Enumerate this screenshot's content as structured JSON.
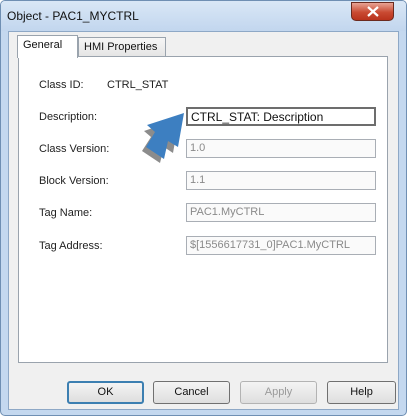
{
  "window": {
    "title": "Object - PAC1_MYCTRL"
  },
  "tabs": [
    {
      "label": "General"
    },
    {
      "label": "HMI Properties"
    }
  ],
  "general": {
    "class_id_label": "Class ID:",
    "class_id_value": "CTRL_STAT",
    "description_label": "Description:",
    "description_value": "CTRL_STAT: Description",
    "class_version_label": "Class Version:",
    "class_version_value": "1.0",
    "block_version_label": "Block Version:",
    "block_version_value": "1.1",
    "tag_name_label": "Tag Name:",
    "tag_name_value": "PAC1.MyCTRL",
    "tag_address_label": "Tag Address:",
    "tag_address_value": "$[1556617731_0]PAC1.MyCTRL"
  },
  "buttons": {
    "ok": "OK",
    "cancel": "Cancel",
    "apply": "Apply",
    "help": "Help"
  },
  "icons": {
    "close": "close-icon",
    "pointer": "pointer-arrow-icon"
  },
  "colors": {
    "title_bar": "#c2d6ee",
    "close_button": "#c94a32",
    "pointer_arrow": "#3d7fc1"
  }
}
